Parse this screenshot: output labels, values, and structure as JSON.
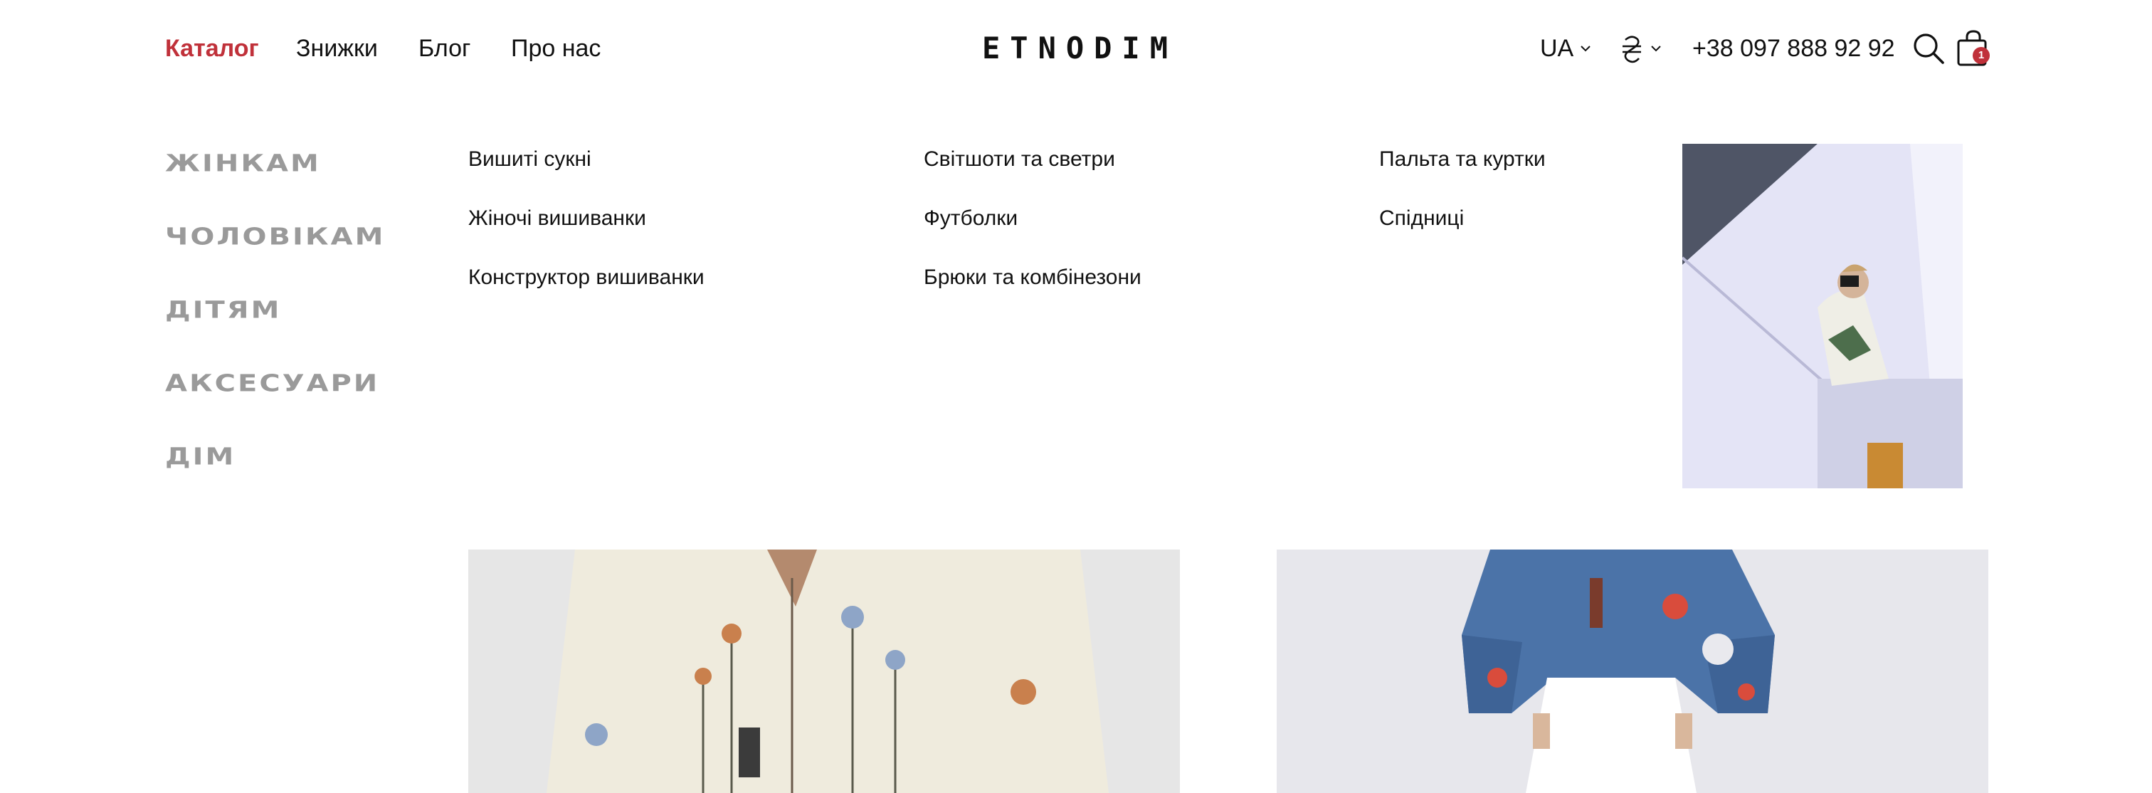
{
  "header": {
    "nav": [
      "Каталог",
      "Знижки",
      "Блог",
      "Про нас"
    ],
    "logo": "ETNODIM",
    "language": "UA",
    "currency_icon": "hryvnia-sign-icon",
    "phone": "+38 097 888 92 92",
    "cart_count": "1"
  },
  "colors": {
    "accent": "#c0313a",
    "category_gray": "#9a9a9a",
    "text": "#111111"
  },
  "menu": {
    "categories": [
      "ЖІНКАМ",
      "ЧОЛОВІКАМ",
      "ДІТЯМ",
      "АКСЕСУАРИ",
      "ДІМ"
    ],
    "col1": [
      "Вишиті сукні",
      "Жіночі вишиванки",
      "Конструктор вишиванки"
    ],
    "col2": [
      "Світшоти та светри",
      "Футболки",
      "Брюки та комбінезони"
    ],
    "col3": [
      "Пальта та куртки",
      "Спідниці"
    ]
  }
}
